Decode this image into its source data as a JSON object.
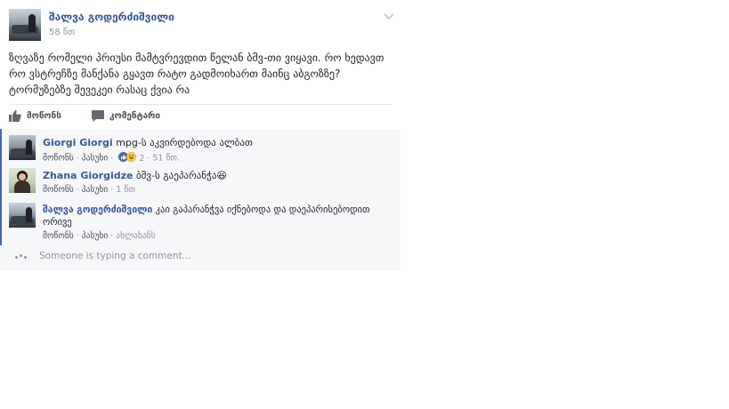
{
  "post": {
    "author": "შალვა გოდერძიშვილი",
    "time": "58 წთ",
    "text_lines": [
      "ზღვაზე რომელი პრიუსი მამტვრევდით წელან ბმვ-თი ვიყავი. რო ხედავთ",
      "რო ვსტრეჩზე მანქანა გყავთ რატო გადმოიხართ მაინც აბგოზზე?",
      "ტორმუზებზე შევეკეი რასაც ქვია რა"
    ]
  },
  "actions": {
    "like_label": "მოწონს",
    "comment_label": "კომენტარი"
  },
  "comments": [
    {
      "author": "Giorgi Giorgi",
      "text": "mpg-ს აკვირდებოდა ალბათ",
      "like": "მოწონს",
      "reply": "პასუხი",
      "reaction_count": "2",
      "time": "51 წთ."
    },
    {
      "author": "Zhana Giorgidze",
      "text": "ბმვ-ს გაეპარანჭა",
      "emoji": "😆",
      "like": "მოწონს",
      "reply": "პასუხი",
      "time": "1 წთ"
    },
    {
      "author": "შალვა გოდერძიშვილი",
      "text": "კაი გაპარანჭვა იქნებოდა და დაეპარისებოდით",
      "text2": "ორივე",
      "like": "მოწონს",
      "reply": "პასუხი",
      "time": "ახლახანს"
    }
  ],
  "typing": "Someone is typing a comment...",
  "colors": {
    "link_blue": "#365899",
    "muted": "#90949c",
    "comment_bg": "#f6f7f9",
    "accent_bar": "#4267b2"
  },
  "icons": [
    "chevron-down-icon",
    "thumbs-up-icon",
    "comment-bubble-icon",
    "like-reaction-icon",
    "haha-reaction-icon",
    "typing-dots-icon"
  ]
}
